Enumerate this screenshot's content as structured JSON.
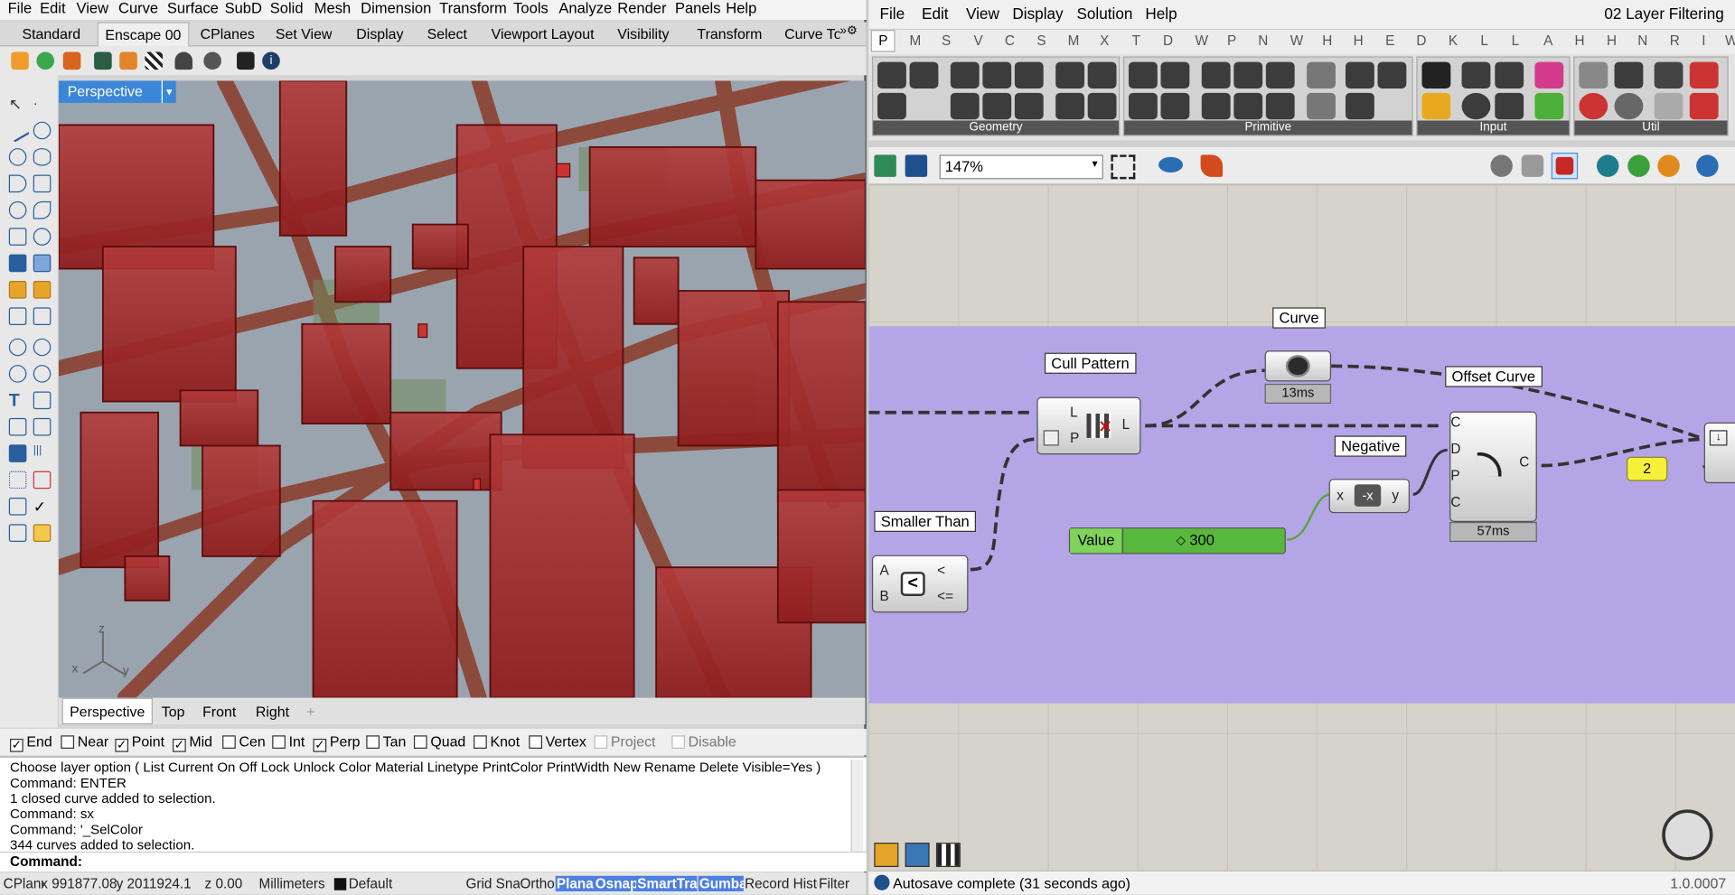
{
  "rhino": {
    "menu": [
      "File",
      "Edit",
      "View",
      "Curve",
      "Surface",
      "SubD",
      "Solid",
      "Mesh",
      "Dimension",
      "Transform",
      "Tools",
      "Analyze",
      "Render",
      "Panels",
      "Help"
    ],
    "toolbar_tabs": [
      "Standard",
      "Enscape 00",
      "CPlanes",
      "Set View",
      "Display",
      "Select",
      "Viewport Layout",
      "Visibility",
      "Transform",
      "Curve To"
    ],
    "viewport_label": "Perspective",
    "axis": {
      "z": "z",
      "x": "x",
      "y": "y"
    },
    "view_tabs": [
      "Perspective",
      "Top",
      "Front",
      "Right"
    ],
    "osnaps": [
      {
        "label": "End",
        "checked": true
      },
      {
        "label": "Near",
        "checked": false
      },
      {
        "label": "Point",
        "checked": true
      },
      {
        "label": "Mid",
        "checked": true
      },
      {
        "label": "Cen",
        "checked": false
      },
      {
        "label": "Int",
        "checked": false
      },
      {
        "label": "Perp",
        "checked": true
      },
      {
        "label": "Tan",
        "checked": false
      },
      {
        "label": "Quad",
        "checked": false
      },
      {
        "label": "Knot",
        "checked": false
      },
      {
        "label": "Vertex",
        "checked": false
      },
      {
        "label": "Project",
        "checked": false
      },
      {
        "label": "Disable",
        "checked": false
      }
    ],
    "command_history": [
      "Choose layer option ( List  Current  On  Off  Lock  Unlock  Color  Material  Linetype  PrintColor  PrintWidth  New  Rename  Delete  Visible=Yes )",
      "Command: ENTER",
      "1 closed curve added to selection.",
      "Command: sx",
      "Command: '_SelColor",
      "344 curves added to selection."
    ],
    "command_prompt": "Command:",
    "status": {
      "cplane": "CPlane",
      "x": "x 991877.08",
      "y": "y 2011924.1",
      "z": "z 0.00",
      "units": "Millimeters",
      "layer": "Default",
      "grid": "Grid Snap",
      "ortho": "Ortho",
      "planar": "Planar",
      "osnap": "Osnap",
      "smarttrack": "SmartTrack",
      "gumball": "Gumball",
      "record": "Record History",
      "filter": "Filter"
    }
  },
  "gh": {
    "menu": [
      "File",
      "Edit",
      "View",
      "Display",
      "Solution",
      "Help"
    ],
    "document_title": "02 Layer Filtering",
    "tabs": [
      "P",
      "M",
      "S",
      "V",
      "C",
      "S",
      "M",
      "X",
      "T",
      "D",
      "W",
      "P",
      "N",
      "W",
      "H",
      "H",
      "E",
      "D",
      "K",
      "L",
      "L",
      "A",
      "H",
      "H",
      "N",
      "R",
      "I",
      "W"
    ],
    "panels": [
      "Geometry",
      "Primitive",
      "Input",
      "Util"
    ],
    "zoom": "147%",
    "components": {
      "cull_pattern": {
        "tip": "Cull Pattern",
        "in": [
          "L",
          "P"
        ],
        "out": [
          "L"
        ]
      },
      "curve": {
        "tip": "Curve",
        "timer": "13ms"
      },
      "offset_curve": {
        "tip": "Offset Curve",
        "in": [
          "C",
          "D",
          "P",
          "C"
        ],
        "out": [
          "C"
        ],
        "timer": "57ms"
      },
      "negative": {
        "tip": "Negative",
        "in": [
          "x"
        ],
        "out": [
          "y"
        ]
      },
      "smaller_than": {
        "tip": "Smaller Than",
        "in": [
          "A",
          "B"
        ],
        "out": [
          "<",
          "<="
        ]
      },
      "slider": {
        "label": "Value",
        "value": "300"
      },
      "panel_value": "2"
    },
    "status": "Autosave complete (31 seconds ago)",
    "version": "1.0.0007"
  }
}
